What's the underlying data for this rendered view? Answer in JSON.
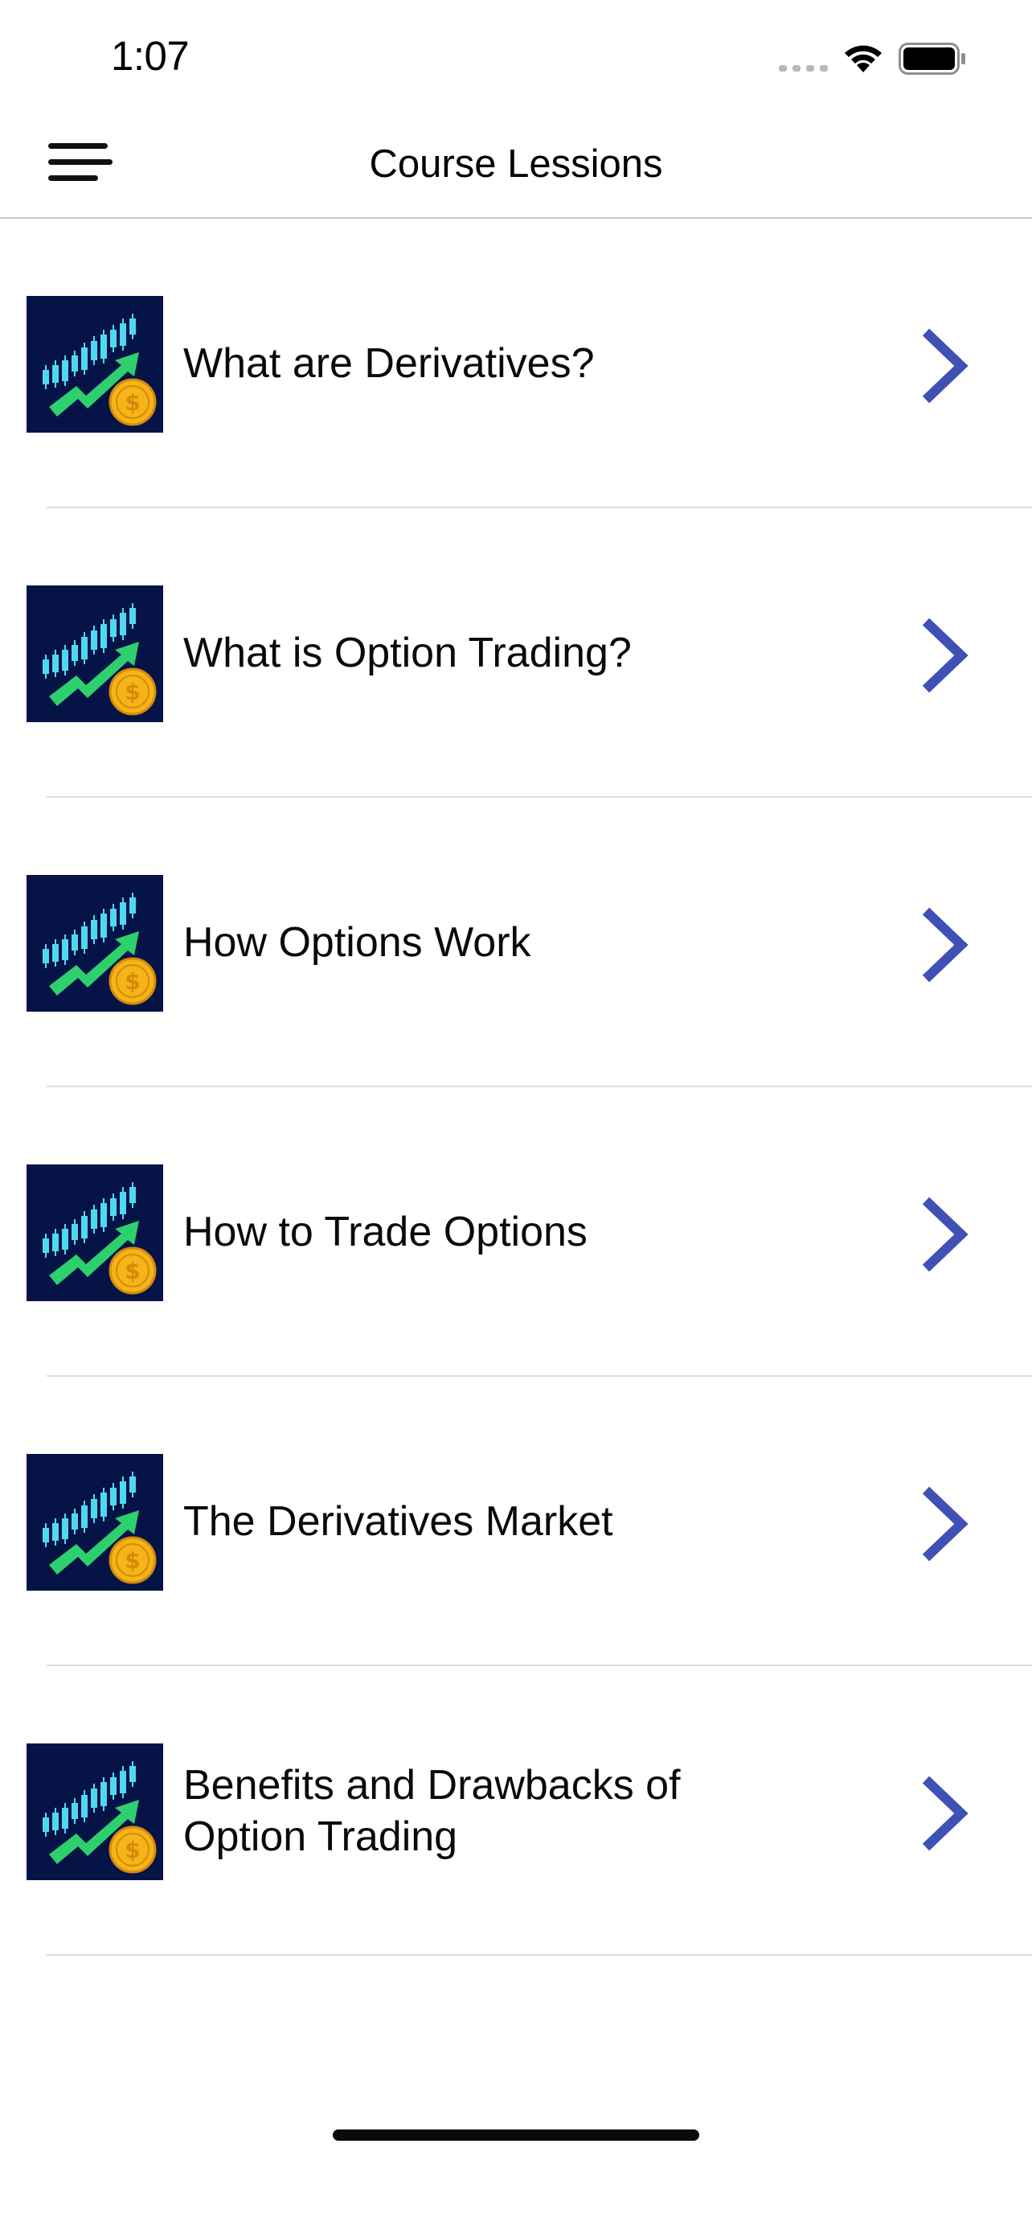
{
  "status_bar": {
    "time": "1:07"
  },
  "nav": {
    "title": "Course Lessions",
    "menu_icon": "hamburger-menu-icon"
  },
  "lessons": [
    {
      "title": "What are Derivatives?",
      "thumbnail_icon": "trading-chart-coin-icon"
    },
    {
      "title": "What is Option Trading?",
      "thumbnail_icon": "trading-chart-coin-icon"
    },
    {
      "title": "How Options Work",
      "thumbnail_icon": "trading-chart-coin-icon"
    },
    {
      "title": "How to Trade Options",
      "thumbnail_icon": "trading-chart-coin-icon"
    },
    {
      "title": "The Derivatives Market",
      "thumbnail_icon": "trading-chart-coin-icon"
    },
    {
      "title": "Benefits and Drawbacks of Option Trading",
      "thumbnail_icon": "trading-chart-coin-icon"
    }
  ],
  "colors": {
    "accent_chevron": "#3F51B5",
    "thumbnail_background": "#051346",
    "thumbnail_arrow": "#2ED06E",
    "thumbnail_coin": "#F5B417",
    "thumbnail_candles": "#4FD8F2"
  }
}
